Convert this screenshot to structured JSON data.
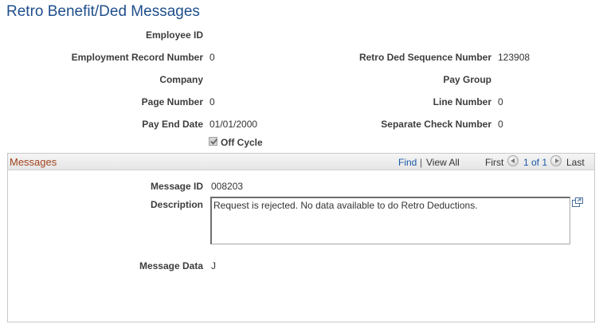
{
  "page_title": "Retro Benefit/Ded Messages",
  "fields": {
    "employee_id": {
      "label": "Employee ID",
      "value": ""
    },
    "empl_rcd": {
      "label": "Employment Record Number",
      "value": "0"
    },
    "company": {
      "label": "Company",
      "value": ""
    },
    "page_number": {
      "label": "Page Number",
      "value": "0"
    },
    "pay_end_date": {
      "label": "Pay End Date",
      "value": "01/01/2000"
    },
    "retro_ded_seq": {
      "label": "Retro Ded Sequence Number",
      "value": "123908"
    },
    "pay_group": {
      "label": "Pay Group",
      "value": ""
    },
    "line_number": {
      "label": "Line Number",
      "value": "0"
    },
    "separate_check": {
      "label": "Separate Check Number",
      "value": "0"
    },
    "off_cycle": {
      "label": "Off Cycle",
      "checked": true
    }
  },
  "messages_grid": {
    "title": "Messages",
    "nav": {
      "find": "Find",
      "separator": "|",
      "view_all": "View All",
      "first": "First",
      "count": "1 of 1",
      "last": "Last"
    },
    "message_id": {
      "label": "Message ID",
      "value": "008203"
    },
    "description": {
      "label": "Description",
      "value": "Request is rejected.  No data available to do Retro Deductions."
    },
    "message_data": {
      "label": "Message Data",
      "value": "J"
    }
  },
  "colors": {
    "title": "#1f4f8c",
    "grid_title": "#a0431d",
    "link": "#1a5aa8"
  },
  "icons": [
    "checkbox-icon",
    "prev-arrow-icon",
    "next-arrow-icon",
    "expand-icon"
  ]
}
